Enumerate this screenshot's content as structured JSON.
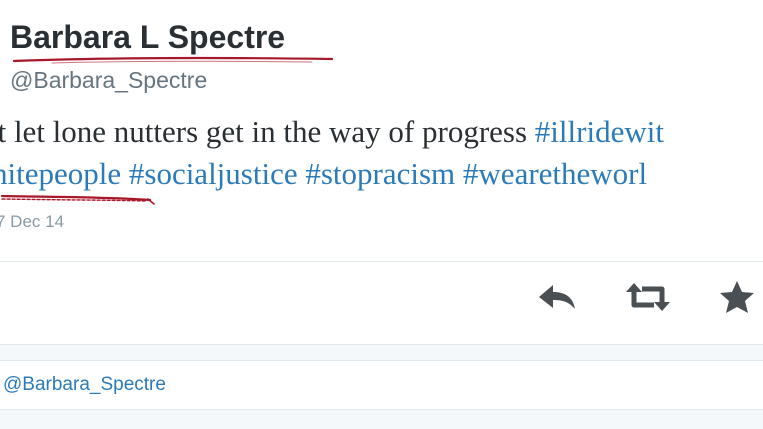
{
  "tweet": {
    "author_name": "Barbara L Spectre",
    "author_handle": "@Barbara_Spectre",
    "line1_text": "'t let lone nutters get in the way of progress ",
    "line1_hashtag": "#illridewit",
    "line2_hashtags": [
      "hitepeople",
      "#socialjustice",
      "#stopracism",
      "#wearetheworl"
    ],
    "date": "7 Dec 14"
  },
  "actions": {
    "reply_icon": "reply-arrow-icon",
    "retweet_icon": "retweet-icon",
    "favorite_icon": "star-icon"
  },
  "reply_box": {
    "value": "@Barbara_Spectre"
  },
  "colors": {
    "text": "#292f33",
    "link": "#2b7bb9",
    "muted": "#66757f",
    "date": "#8899a6",
    "icon": "#4a4f54",
    "annotation_red": "#a8182a",
    "divider": "#e1e8ed"
  }
}
